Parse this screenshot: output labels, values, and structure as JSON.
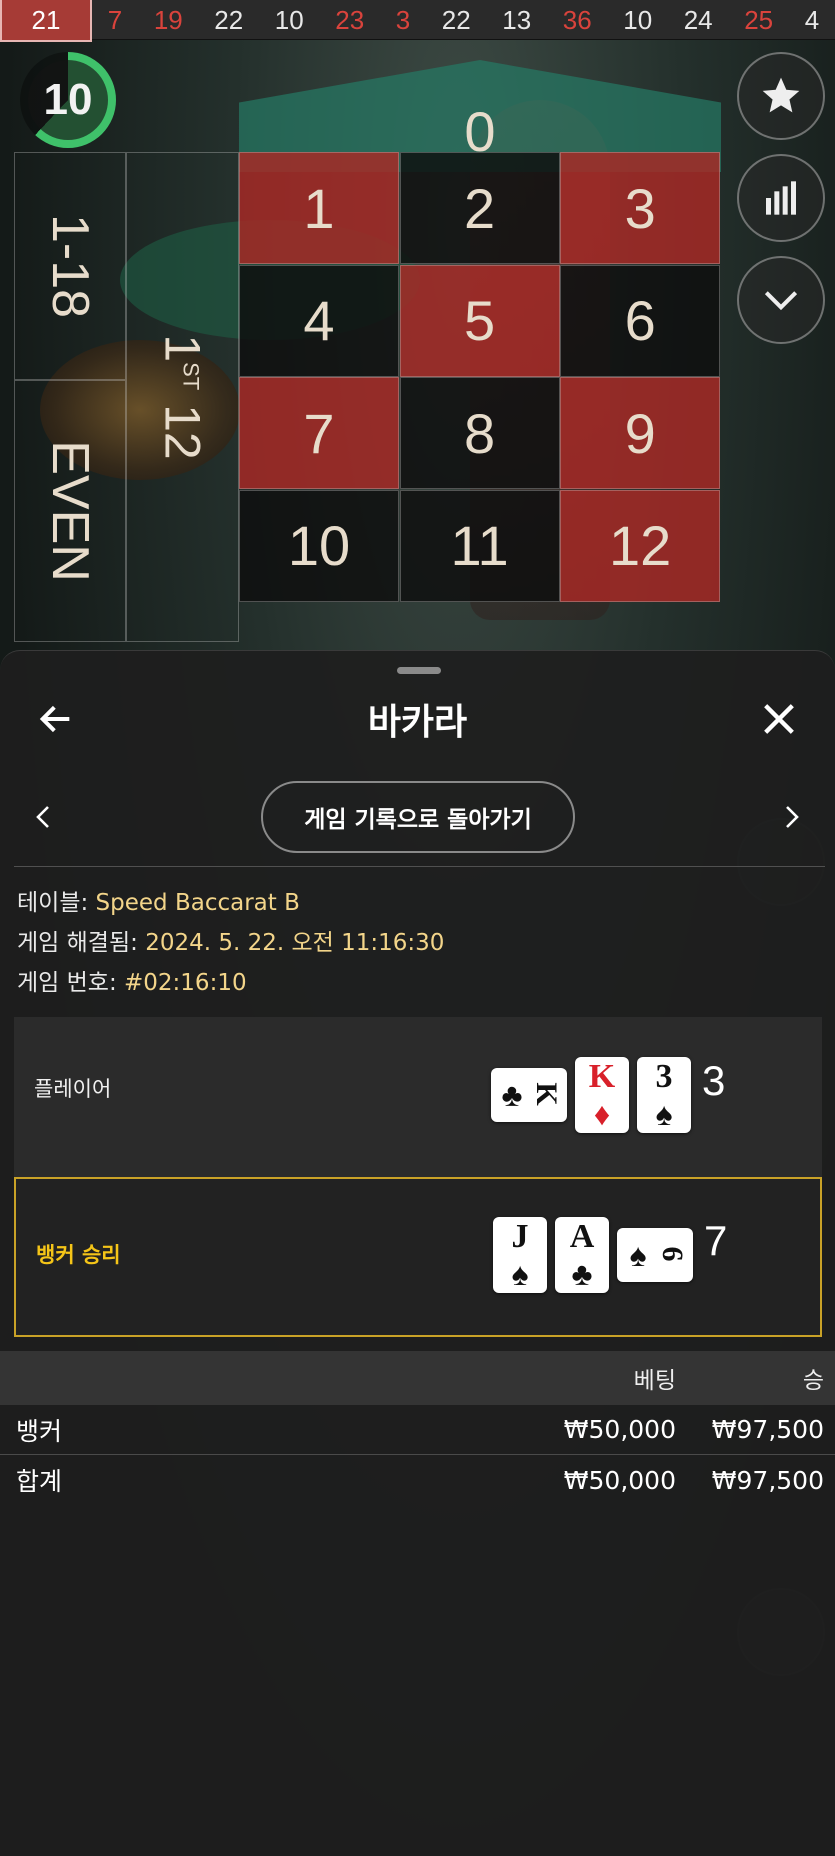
{
  "results": [
    {
      "value": "21",
      "color": "red",
      "latest": true
    },
    {
      "value": "7",
      "color": "red"
    },
    {
      "value": "19",
      "color": "red"
    },
    {
      "value": "22",
      "color": "black"
    },
    {
      "value": "10",
      "color": "black"
    },
    {
      "value": "23",
      "color": "red"
    },
    {
      "value": "3",
      "color": "red"
    },
    {
      "value": "22",
      "color": "black"
    },
    {
      "value": "13",
      "color": "black"
    },
    {
      "value": "36",
      "color": "red"
    },
    {
      "value": "10",
      "color": "black"
    },
    {
      "value": "24",
      "color": "black"
    },
    {
      "value": "25",
      "color": "red"
    },
    {
      "value": "4",
      "color": "black"
    }
  ],
  "timer": {
    "value": "10",
    "progress": 0.62
  },
  "roulette": {
    "zero": "0",
    "numbers": [
      {
        "n": "1",
        "c": "r"
      },
      {
        "n": "2",
        "c": "b"
      },
      {
        "n": "3",
        "c": "r"
      },
      {
        "n": "4",
        "c": "b"
      },
      {
        "n": "5",
        "c": "r"
      },
      {
        "n": "6",
        "c": "b"
      },
      {
        "n": "7",
        "c": "r"
      },
      {
        "n": "8",
        "c": "b"
      },
      {
        "n": "9",
        "c": "r"
      },
      {
        "n": "10",
        "c": "b"
      },
      {
        "n": "11",
        "c": "b"
      },
      {
        "n": "12",
        "c": "r"
      }
    ],
    "range_label": "1-18",
    "even_label": "EVEN",
    "dozen_label": "1",
    "dozen_suffix": "ST",
    "dozen_value": "12"
  },
  "right_buttons": [
    {
      "name": "favorite-button",
      "icon": "star-icon"
    },
    {
      "name": "statistics-button",
      "icon": "bar-chart-icon"
    },
    {
      "name": "collapse-button",
      "icon": "chevron-down-icon"
    }
  ],
  "sheet": {
    "title": "바카라",
    "back_icon": "arrow-left-icon",
    "close_icon": "close-icon",
    "history_button": "게임 기록으로 돌아가기",
    "info": {
      "table_label": "테이블:",
      "table_value": "Speed Baccarat B",
      "resolved_label": "게임 해결됨:",
      "resolved_value": "2024. 5. 22. 오전 11:16:30",
      "number_label": "게임 번호:",
      "number_value": "#02:16:10"
    },
    "player": {
      "label": "플레이어",
      "score": "3",
      "cards": [
        {
          "rank": "K",
          "suit": "♣",
          "color": "blk",
          "side": true
        },
        {
          "rank": "K",
          "suit": "♦",
          "color": "red",
          "side": false
        },
        {
          "rank": "3",
          "suit": "♠",
          "color": "blk",
          "side": false
        }
      ]
    },
    "banker": {
      "label": "뱅커 승리",
      "score": "7",
      "cards": [
        {
          "rank": "J",
          "suit": "♠",
          "color": "blk",
          "side": false
        },
        {
          "rank": "A",
          "suit": "♣",
          "color": "blk",
          "side": false
        },
        {
          "rank": "6",
          "suit": "♠",
          "color": "blk",
          "side": true
        }
      ]
    },
    "bets": {
      "header": {
        "bet": "베팅",
        "win": "승"
      },
      "rows": [
        {
          "name": "뱅커",
          "bet": "₩50,000",
          "win": "₩97,500"
        },
        {
          "name": "합계",
          "bet": "₩50,000",
          "win": "₩97,500"
        }
      ]
    }
  },
  "colors": {
    "accent_gold": "#c9a227",
    "red": "#d9433c",
    "green": "#3fc16a"
  }
}
